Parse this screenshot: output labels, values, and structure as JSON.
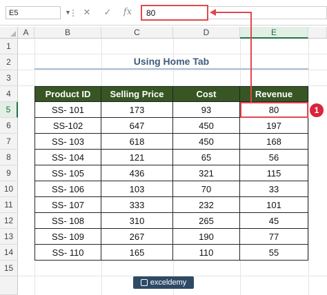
{
  "formula_bar": {
    "name_box": "E5",
    "cancel_icon": "✕",
    "enter_icon": "✓",
    "fx_label": "fx",
    "formula_value": "80"
  },
  "columns": [
    "A",
    "B",
    "C",
    "D",
    "E"
  ],
  "rows": [
    "1",
    "2",
    "3",
    "4",
    "5",
    "6",
    "7",
    "8",
    "9",
    "10",
    "11",
    "12",
    "13",
    "14",
    "15"
  ],
  "title": "Using Home Tab",
  "table": {
    "headers": [
      "Product ID",
      "Selling Price",
      "Cost",
      "Revenue"
    ],
    "rows": [
      [
        "SS- 101",
        "173",
        "93",
        "80"
      ],
      [
        "SS-102",
        "647",
        "450",
        "197"
      ],
      [
        "SS- 103",
        "618",
        "450",
        "168"
      ],
      [
        "SS- 104",
        "121",
        "65",
        "56"
      ],
      [
        "SS- 105",
        "436",
        "321",
        "115"
      ],
      [
        "SS- 106",
        "103",
        "70",
        "33"
      ],
      [
        "SS- 107",
        "333",
        "232",
        "101"
      ],
      [
        "SS- 108",
        "310",
        "265",
        "45"
      ],
      [
        "SS- 109",
        "267",
        "190",
        "77"
      ],
      [
        "SS- 110",
        "165",
        "110",
        "55"
      ]
    ]
  },
  "selected_cell": "E5",
  "callout_number": "1",
  "accent_color": "#e0474c",
  "header_fill_color": "#375623",
  "watermark": "exceldemy"
}
